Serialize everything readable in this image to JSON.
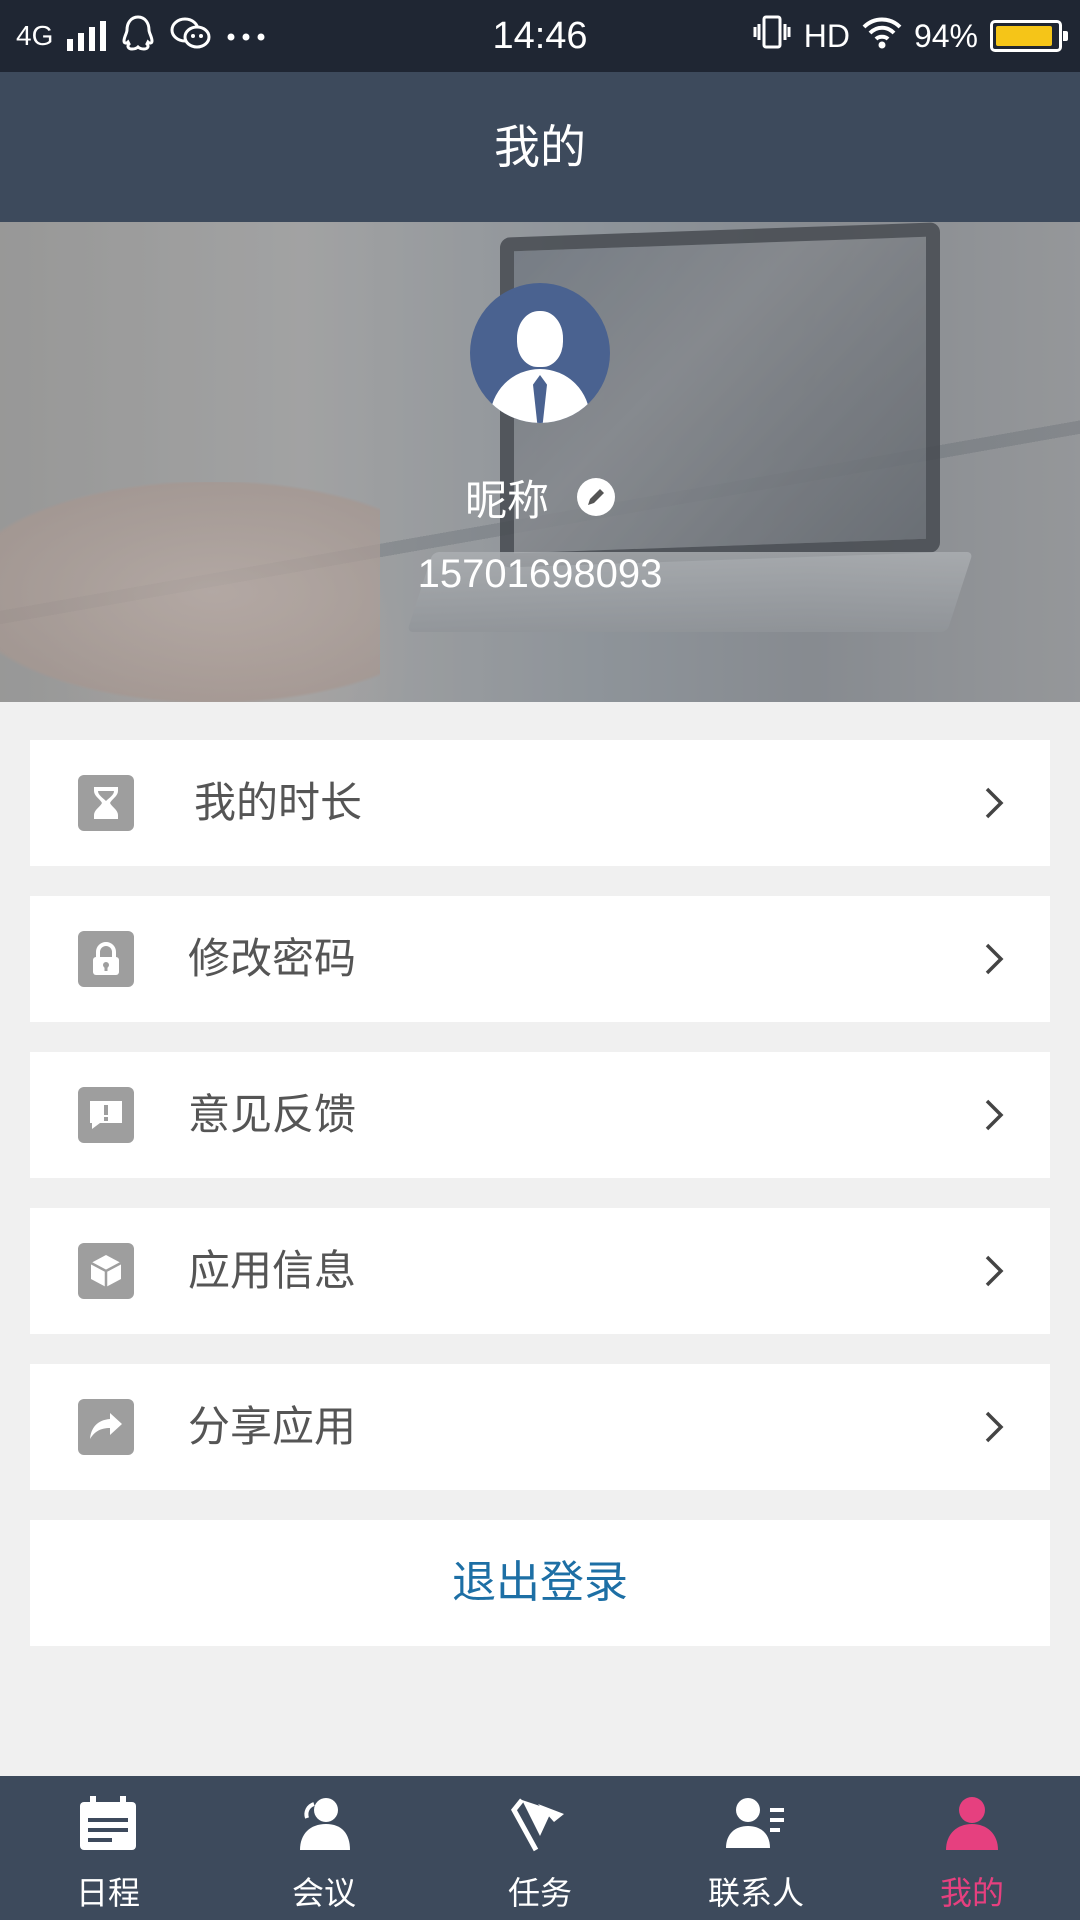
{
  "status_bar": {
    "network": "4G",
    "time": "14:46",
    "hd": "HD",
    "battery": "94%",
    "battery_level": 0.94,
    "icons": [
      "signal-icon",
      "qq-icon",
      "wechat-icon",
      "more-icon",
      "vibrate-icon",
      "wifi-icon",
      "battery-icon"
    ]
  },
  "header": {
    "title": "我的"
  },
  "profile": {
    "nickname": "昵称",
    "phone": "15701698093"
  },
  "menu": {
    "items": [
      {
        "label": "我的时长",
        "icon": "hourglass-icon"
      },
      {
        "label": "修改密码",
        "icon": "lock-icon"
      },
      {
        "label": "意见反馈",
        "icon": "feedback-icon"
      },
      {
        "label": "应用信息",
        "icon": "cube-icon"
      },
      {
        "label": "分享应用",
        "icon": "share-icon"
      }
    ],
    "logout_label": "退出登录"
  },
  "bottom_nav": {
    "items": [
      {
        "label": "日程",
        "icon": "calendar-icon",
        "active": false
      },
      {
        "label": "会议",
        "icon": "meeting-icon",
        "active": false
      },
      {
        "label": "任务",
        "icon": "task-flag-icon",
        "active": false
      },
      {
        "label": "联系人",
        "icon": "contacts-icon",
        "active": false
      },
      {
        "label": "我的",
        "icon": "profile-icon",
        "active": true
      }
    ]
  },
  "colors": {
    "status_bar": "#1f2633",
    "title_bar": "#3d4a5c",
    "nav_bar": "#3d4a5c",
    "active_tab": "#e6407f",
    "logout_text": "#1d6fa5",
    "menu_icon": "#9e9e9e",
    "battery_fill": "#f5c518"
  }
}
